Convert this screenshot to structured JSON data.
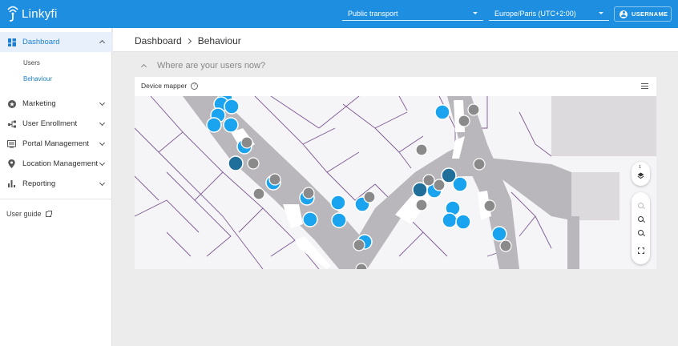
{
  "app": {
    "brand": "Linkyfi"
  },
  "topbar": {
    "transport_select": "Public transport",
    "timezone_select": "Europe/Paris (UTC+2:00)",
    "user_label": "USERNAME"
  },
  "sidebar": {
    "items": [
      {
        "label": "Dashboard",
        "icon": "dashboard-icon",
        "expanded": true
      },
      {
        "label": "Marketing",
        "icon": "star-badge-icon"
      },
      {
        "label": "User Enrollment",
        "icon": "share-nodes-icon"
      },
      {
        "label": "Portal Management",
        "icon": "screen-icon"
      },
      {
        "label": "Location Management",
        "icon": "location-pin-icon"
      },
      {
        "label": "Reporting",
        "icon": "bar-chart-icon"
      }
    ],
    "subitems": [
      {
        "label": "Users"
      },
      {
        "label": "Behaviour",
        "active": true
      }
    ],
    "user_guide": "User guide"
  },
  "breadcrumb": {
    "root": "Dashboard",
    "current": "Behaviour"
  },
  "section": {
    "title": "Where are your users now?"
  },
  "card": {
    "title": "Device mapper"
  },
  "map": {
    "layer_level": "1",
    "colors": {
      "device_blue": "#1aa3ef",
      "device_dark": "#1f6f9a",
      "device_grey": "#8a8a8a",
      "corridor": "#b9b6bc",
      "wall": "#6b4f7e"
    }
  }
}
